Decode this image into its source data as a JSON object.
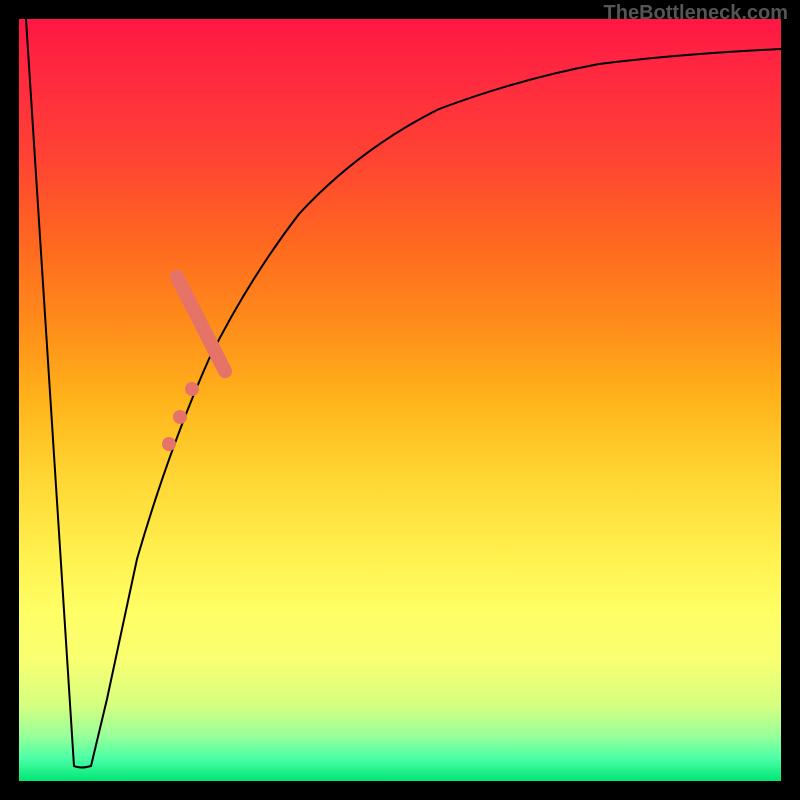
{
  "watermark": "TheBottleneck.com",
  "chart_data": {
    "type": "line",
    "title": "",
    "xlabel": "",
    "ylabel": "",
    "xlim": [
      0,
      100
    ],
    "ylim": [
      0,
      100
    ],
    "gradient": {
      "top": "#ff1744",
      "mid": "#ffff66",
      "bottom": "#00e676"
    },
    "series": [
      {
        "name": "bottleneck-curve",
        "color": "#000000",
        "points": [
          {
            "x": 1.0,
            "y": 100
          },
          {
            "x": 7.0,
            "y": 2
          },
          {
            "x": 9.5,
            "y": 2
          },
          {
            "x": 12,
            "y": 12
          },
          {
            "x": 16,
            "y": 30
          },
          {
            "x": 20,
            "y": 44
          },
          {
            "x": 25,
            "y": 56
          },
          {
            "x": 30,
            "y": 66
          },
          {
            "x": 36,
            "y": 75
          },
          {
            "x": 44,
            "y": 82
          },
          {
            "x": 54,
            "y": 88
          },
          {
            "x": 66,
            "y": 92
          },
          {
            "x": 80,
            "y": 94.5
          },
          {
            "x": 100,
            "y": 96
          }
        ]
      }
    ],
    "markers": {
      "bar": {
        "x_start": 24,
        "x_end": 31,
        "y_start": 54,
        "y_end": 68,
        "color": "#e57368",
        "width": 14
      },
      "dots": [
        {
          "x": 23.0,
          "y": 51.5
        },
        {
          "x": 21.5,
          "y": 48.0
        },
        {
          "x": 20.0,
          "y": 44.0
        }
      ]
    },
    "annotations": []
  }
}
